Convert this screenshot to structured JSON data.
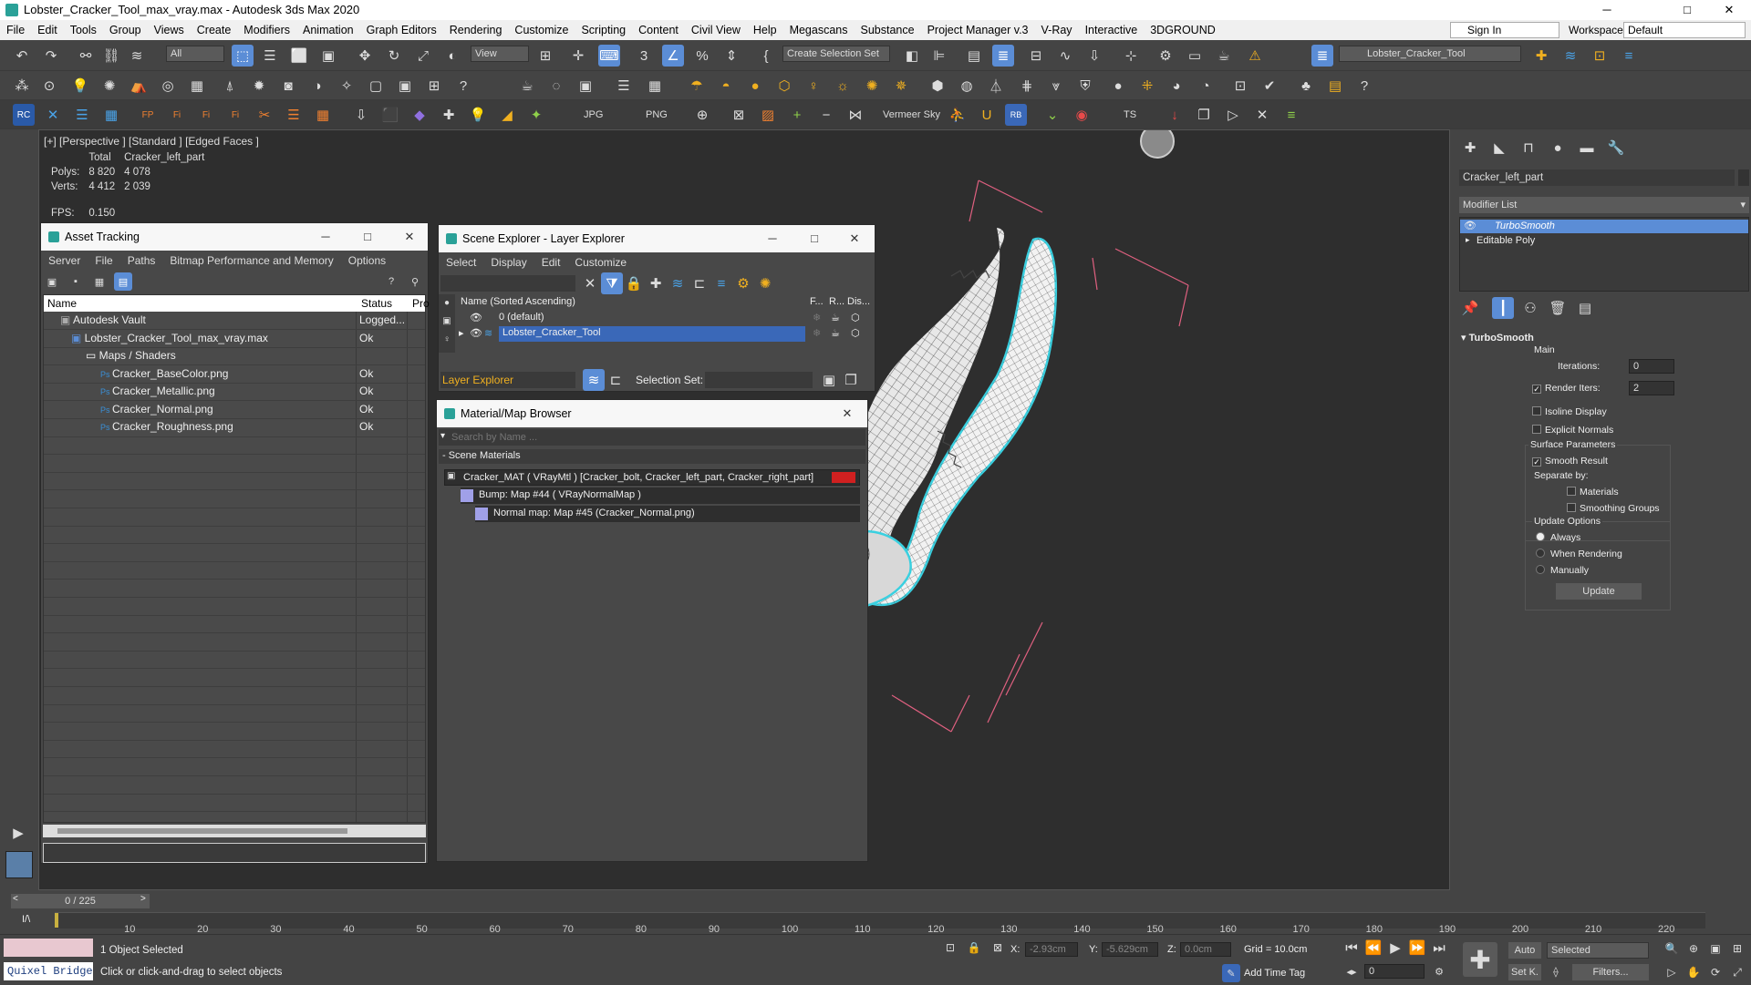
{
  "window": {
    "title": "Lobster_Cracker_Tool_max_vray.max - Autodesk 3ds Max 2020",
    "minimize": "─",
    "maximize": "□",
    "close": "✕"
  },
  "menubar": {
    "items": [
      "File",
      "Edit",
      "Tools",
      "Group",
      "Views",
      "Create",
      "Modifiers",
      "Animation",
      "Graph Editors",
      "Rendering",
      "Customize",
      "Scripting",
      "Content",
      "Civil View",
      "Help",
      "Megascans",
      "Substance",
      "Project Manager v.3",
      "V-Ray",
      "Interactive",
      "3DGROUND"
    ],
    "sign_in": "Sign In",
    "workspaces_label": "Workspaces:",
    "workspace_value": "Default"
  },
  "toolbar": {
    "filter_value": "All",
    "view_value": "View",
    "selection_set_value": "Create Selection Set",
    "layer_value": "Lobster_Cracker_Tool",
    "jpg": "JPG",
    "png": "PNG",
    "vermeer": "Vermeer Sky",
    "ts": "TS"
  },
  "viewport": {
    "label": "[+] [Perspective ] [Standard ] [Edged Faces ]",
    "stats": {
      "total_header": "Total",
      "object_header": "Cracker_left_part",
      "polys_label": "Polys:",
      "polys_total": "8 820",
      "polys_obj": "4 078",
      "verts_label": "Verts:",
      "verts_total": "4 412",
      "verts_obj": "2 039",
      "fps_label": "FPS:",
      "fps_value": "0.150"
    }
  },
  "asset_tracking": {
    "title": "Asset Tracking",
    "menu": [
      "Server",
      "File",
      "Paths",
      "Bitmap Performance and Memory",
      "Options"
    ],
    "columns": [
      "Name",
      "Status",
      "Pro"
    ],
    "rows": [
      {
        "name": "Autodesk Vault",
        "status": "Logged..."
      },
      {
        "name": "Lobster_Cracker_Tool_max_vray.max",
        "status": "Ok"
      },
      {
        "name": "Maps / Shaders",
        "status": ""
      },
      {
        "name": "Cracker_BaseColor.png",
        "status": "Ok"
      },
      {
        "name": "Cracker_Metallic.png",
        "status": "Ok"
      },
      {
        "name": "Cracker_Normal.png",
        "status": "Ok"
      },
      {
        "name": "Cracker_Roughness.png",
        "status": "Ok"
      }
    ]
  },
  "scene_explorer": {
    "title": "Scene Explorer - Layer Explorer",
    "menu": [
      "Select",
      "Display",
      "Edit",
      "Customize"
    ],
    "col_name": "Name (Sorted Ascending)",
    "col_f": "F...",
    "col_r": "R...",
    "col_d": "Dis...",
    "rows": [
      "0 (default)",
      "Lobster_Cracker_Tool"
    ],
    "footer_explorer": "Layer Explorer",
    "footer_selset": "Selection Set:"
  },
  "material_browser": {
    "title": "Material/Map Browser",
    "search_placeholder": "Search by Name ...",
    "section": "- Scene Materials",
    "items": [
      "Cracker_MAT  ( VRayMtl )  [Cracker_bolt, Cracker_left_part, Cracker_right_part]",
      "Bump: Map #44  ( VRayNormalMap )",
      "Normal map: Map #45 (Cracker_Normal.png)"
    ]
  },
  "command_panel": {
    "object_name": "Cracker_left_part",
    "modifier_list": "Modifier List",
    "stack": [
      "TurboSmooth",
      "Editable Poly"
    ],
    "rollout_title": "TurboSmooth",
    "main_label": "Main",
    "iterations_label": "Iterations:",
    "iterations_value": "0",
    "render_iters_label": "Render Iters:",
    "render_iters_value": "2",
    "isoline": "Isoline Display",
    "explicit": "Explicit Normals",
    "surface_params": "Surface Parameters",
    "smooth_result": "Smooth Result",
    "separate_by": "Separate by:",
    "materials": "Materials",
    "smoothing_groups": "Smoothing Groups",
    "update_options": "Update Options",
    "always": "Always",
    "when_rendering": "When Rendering",
    "manually": "Manually",
    "update_button": "Update"
  },
  "timeline": {
    "frame_counter": "0 / 225",
    "ticks": [
      "10",
      "20",
      "30",
      "40",
      "50",
      "60",
      "70",
      "80",
      "90",
      "100",
      "110",
      "120",
      "130",
      "140",
      "150",
      "160",
      "170",
      "180",
      "190",
      "200",
      "210",
      "220"
    ]
  },
  "statusbar": {
    "quixel": "Quixel Bridge",
    "status1": "1 Object Selected",
    "status2": "Click or click-and-drag to select objects",
    "x_label": "X:",
    "x_value": "-2.93cm",
    "y_label": "Y:",
    "y_value": "-5.629cm",
    "z_label": "Z:",
    "z_value": "0.0cm",
    "grid": "Grid = 10.0cm",
    "add_time_tag": "Add Time Tag",
    "auto": "Auto",
    "set_key": "Set K.",
    "selected_value": "Selected",
    "filters": "Filters...",
    "frame_value": "0"
  },
  "colors": {
    "accent": "#5b8dd6",
    "selection": "#3a68b8",
    "viewport_bg": "#2e2e2e",
    "wire_highlight": "#3ad0e0",
    "bbox": "#e06080"
  }
}
